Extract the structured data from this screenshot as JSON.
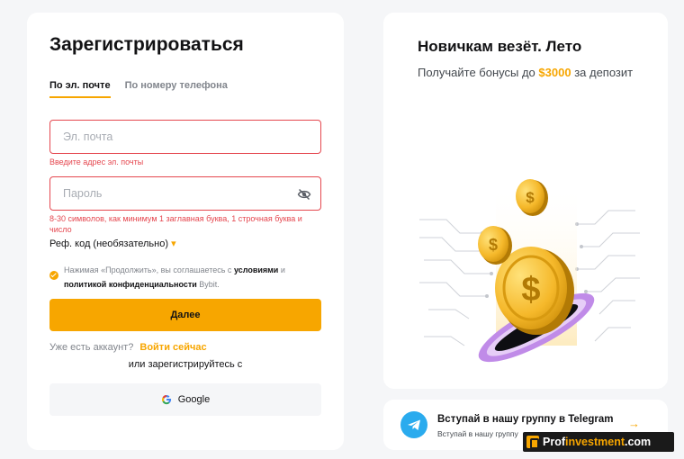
{
  "form": {
    "title": "Зарегистрироваться",
    "tabs": [
      {
        "label": "По эл. почте",
        "active": true
      },
      {
        "label": "По номеру телефона",
        "active": false
      }
    ],
    "email": {
      "placeholder": "Эл. почта",
      "value": "",
      "error": "Введите адрес эл. почты"
    },
    "password": {
      "placeholder": "Пароль",
      "value": "",
      "error": "8-30 символов, как минимум 1 заглавная буква, 1 строчная буква и число",
      "eye_icon": "eye-slash-icon"
    },
    "referral": {
      "label": "Реф. код (необязательно)",
      "marker": "▾"
    },
    "agreement": {
      "checked": true,
      "text_before": "Нажимая «Продолжить», вы соглашаетесь с",
      "terms_link": "условиями",
      "and": "и",
      "privacy_link": "политикой конфиденциальности",
      "text_after": "Bybit."
    },
    "submit_label": "Далее",
    "have_account": "Уже есть аккаунт?",
    "login_link": "Войти сейчас",
    "or_register_with": "или зарегистрируйтесь с",
    "google_label": "Google"
  },
  "promo": {
    "title": "Новичкам везёт. Лето",
    "text_before": "Получайте бонусы до",
    "amount": "$3000",
    "text_after": "за депозит",
    "coin_symbol": "$"
  },
  "telegram": {
    "title": "Вступай в нашу группу в Telegram",
    "subtitle": "Вступай в нашу группу",
    "arrow": "→"
  },
  "watermark": {
    "part1": "Prof",
    "part2": "investment",
    "part3": ".com"
  },
  "colors": {
    "accent": "#f7a600",
    "error": "#e5474f",
    "telegram": "#2aabee",
    "page_bg": "#f5f6f8"
  }
}
